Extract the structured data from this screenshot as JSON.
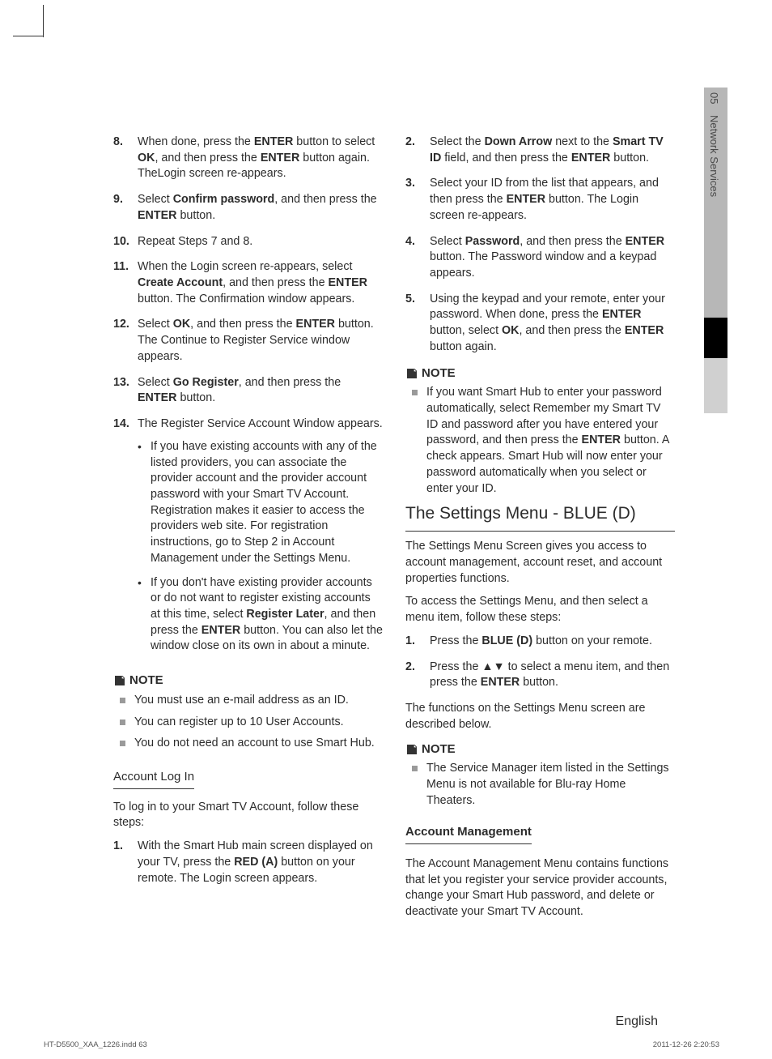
{
  "sidebar": {
    "chapter_num": "05",
    "chapter_name": "Network Services"
  },
  "left": {
    "s8": {
      "n": "8.",
      "pre": "When done, press the ",
      "b1": "ENTER",
      "mid1": " button to select ",
      "b2": "OK",
      "mid2": ", and then press the ",
      "b3": "ENTER",
      "post": " button again. TheLogin screen re-appears."
    },
    "s9": {
      "n": "9.",
      "pre": "Select ",
      "b1": "Confirm password",
      "mid": ", and then press the ",
      "b2": "ENTER",
      "post": " button."
    },
    "s10": {
      "n": "10.",
      "t": "Repeat Steps 7 and 8."
    },
    "s11": {
      "n": "11.",
      "pre": "When the Login screen re-appears, select ",
      "b1": "Create Account",
      "mid": ", and then press the ",
      "b2": "ENTER",
      "post": " button. The Confirmation window appears."
    },
    "s12": {
      "n": "12.",
      "pre": "Select ",
      "b1": "OK",
      "mid": ", and then press the ",
      "b2": "ENTER",
      "post": " button. The Continue to Register Service window appears."
    },
    "s13": {
      "n": "13.",
      "pre": "Select ",
      "b1": "Go Register",
      "mid": ", and then press the ",
      "b2": "ENTER",
      "post": " button."
    },
    "s14": {
      "n": "14.",
      "t": "The Register Service Account Window appears."
    },
    "s14b1": "If you have existing accounts with any of the listed providers, you can associate the provider account and the provider account password with your Smart TV Account. Registration makes it easier to access the providers web site. For registration instructions, go to Step 2 in Account Management under the Settings Menu.",
    "s14b2": {
      "pre": "If you don't have existing provider accounts or do not want to register existing accounts at this time, select ",
      "b1": "Register Later",
      "mid": ", and then press the ",
      "b2": "ENTER",
      "post": " button. You can also let the window close on its own in about a minute."
    },
    "note_label": "NOTE",
    "n1": "You must use an e-mail address as an ID.",
    "n2": "You can register up to 10 User Accounts.",
    "n3": "You do not need an account to use Smart Hub.",
    "login_head": "Account Log In",
    "login_intro": "To log in to your Smart TV Account, follow these steps:",
    "l1": {
      "n": "1.",
      "pre": "With the Smart Hub main screen displayed on your TV, press the ",
      "b1": "RED (A)",
      "post": " button on your remote. The Login screen appears."
    }
  },
  "right": {
    "s2": {
      "n": "2.",
      "pre": "Select the ",
      "b1": "Down Arrow",
      "mid1": " next to the ",
      "b2": "Smart TV ID",
      "mid2": " field, and then press the ",
      "b3": "ENTER",
      "post": " button."
    },
    "s3": {
      "n": "3.",
      "pre": "Select your ID from the list that appears, and then press the ",
      "b1": "ENTER",
      "post": " button. The Login screen re-appears."
    },
    "s4": {
      "n": "4.",
      "pre": "Select ",
      "b1": "Password",
      "mid": ", and then press the ",
      "b2": "ENTER",
      "post": " button. The Password window and a keypad appears."
    },
    "s5": {
      "n": "5.",
      "pre": "Using the keypad and your remote, enter your password. When done, press the ",
      "b1": "ENTER",
      "mid1": " button, select ",
      "b2": "OK",
      "mid2": ", and then press the ",
      "b3": "ENTER",
      "post": " button again."
    },
    "note_label": "NOTE",
    "note1": {
      "pre": "If you want Smart Hub to enter your password automatically, select Remember my Smart TV ID and password after you have entered your password, and then press the ",
      "b1": "ENTER",
      "post": " button. A check appears. Smart Hub will now enter your password automatically when you select or enter your ID."
    },
    "section_head": "The Settings Menu - BLUE (D)",
    "sec_p1": "The Settings Menu Screen gives you access to account management, account reset, and account properties functions.",
    "sec_p2": "To access the Settings Menu, and then select a menu item, follow these steps:",
    "m1": {
      "n": "1.",
      "pre": "Press the ",
      "b1": "BLUE (D)",
      "post": " button on your remote."
    },
    "m2": {
      "n": "2.",
      "pre": "Press the ",
      "arrows": "▲▼",
      "mid": " to select a menu item, and then press the ",
      "b1": "ENTER",
      "post": " button."
    },
    "sec_p3": "The functions on the Settings Menu screen are described below.",
    "note2_label": "NOTE",
    "note2": "The Service Manager item listed in the Settings Menu is not available for Blu-ray Home Theaters.",
    "am_head": "Account Management",
    "am_p": "The Account Management Menu contains functions that let you register your service provider accounts, change your Smart Hub password, and delete or deactivate your Smart TV Account."
  },
  "footer": {
    "lang": "English",
    "indd": "HT-D5500_XAA_1226.indd   63",
    "datetime": "2011-12-26   2:20:53"
  }
}
